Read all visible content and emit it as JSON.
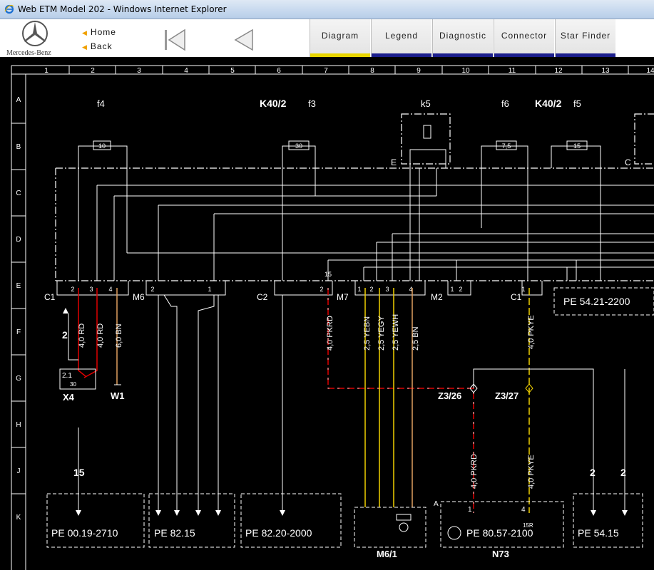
{
  "window": {
    "title": "Web ETM Model 202 - Windows Internet Explorer"
  },
  "toolbar": {
    "logo_text": "Mercedes-Benz",
    "home_label": "Home",
    "back_label": "Back",
    "tabs": [
      {
        "label": "Diagram",
        "active": true
      },
      {
        "label": "Legend",
        "active": false
      },
      {
        "label": "Diagnostic",
        "active": false
      },
      {
        "label": "Connector",
        "active": false
      },
      {
        "label": "Star Finder",
        "active": false
      }
    ]
  },
  "diagram": {
    "columns": [
      "1",
      "2",
      "3",
      "4",
      "5",
      "6",
      "7",
      "8",
      "9",
      "10",
      "11",
      "12",
      "13",
      "14"
    ],
    "rows": [
      "A",
      "B",
      "C",
      "D",
      "E",
      "F",
      "G",
      "H",
      "J",
      "K"
    ],
    "fuses": [
      "f4",
      "f3",
      "k5",
      "f6",
      "f5"
    ],
    "fuse_values": [
      "10",
      "30",
      "7,5",
      "15"
    ],
    "modules": [
      "K40/2",
      "K40/2"
    ],
    "connectors": [
      "C1",
      "M6",
      "C2",
      "M7",
      "M2",
      "C1",
      "E",
      "C"
    ],
    "pins": [
      "2",
      "3",
      "4",
      "2",
      "1",
      "2",
      "15",
      "1",
      "2",
      "3",
      "4",
      "1",
      "2",
      "1"
    ],
    "wire_labels": [
      "4,0 RD",
      "4,0 RD",
      "6,0 BN",
      "4,0 PKRD",
      "2,5 YEBN",
      "2,5 YEGY",
      "2,5 YEWH",
      "2,5 BN",
      "4,0 PKYE",
      "4,0 PKRD",
      "4,0 PKYE"
    ],
    "components": [
      "X4",
      "W1",
      "Z3/26",
      "Z3/27",
      "M6/1",
      "N73"
    ],
    "x4_pins": [
      "2.1",
      "30"
    ],
    "arrow_numbers": [
      "2",
      "15",
      "2",
      "2"
    ],
    "n73_marks": [
      "A",
      "1",
      "4",
      "15R"
    ],
    "references": [
      "PE 00.19-2710",
      "PE 82.15",
      "PE 82.20-2000",
      "PE 80.57-2100",
      "PE 54.15",
      "PE 54.21-2200"
    ]
  }
}
